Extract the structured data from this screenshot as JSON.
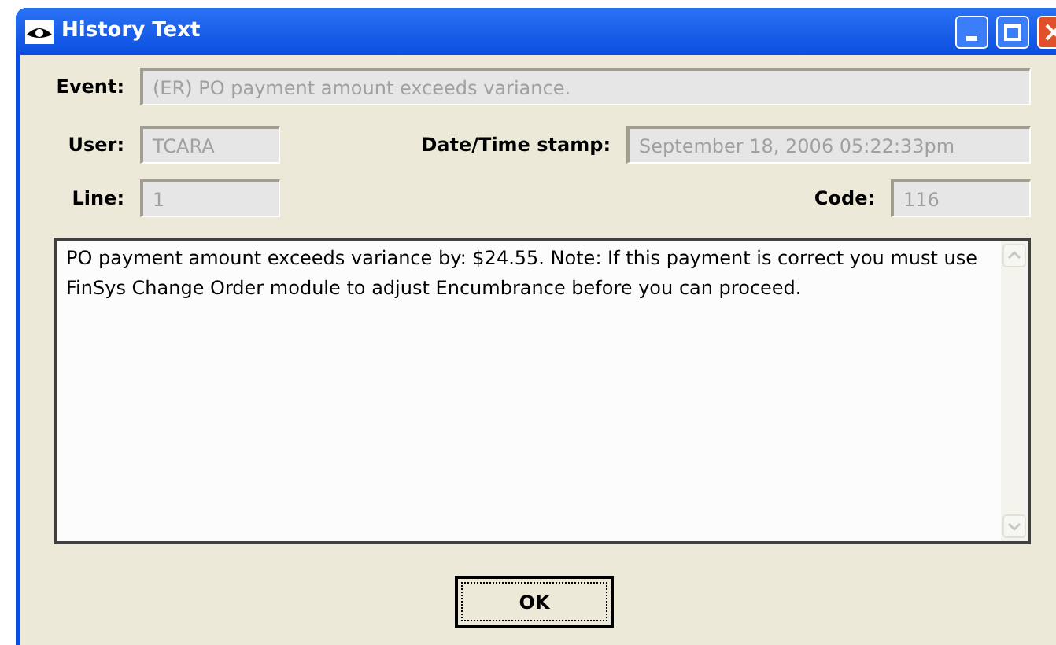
{
  "window": {
    "title": "History Text"
  },
  "fields": {
    "event": {
      "label": "Event:",
      "value": "(ER) PO payment amount exceeds variance.",
      "disabled": true
    },
    "user": {
      "label": "User:",
      "value": "TCARA",
      "disabled": true
    },
    "timestamp": {
      "label": "Date/Time stamp:",
      "value": "September 18, 2006 05:22:33pm",
      "disabled": true
    },
    "line": {
      "label": "Line:",
      "value": "1",
      "disabled": true
    },
    "code": {
      "label": "Code:",
      "value": "116",
      "disabled": true
    }
  },
  "message": "PO payment amount exceeds variance by: $24.55. Note: If this payment is correct you must use FinSys Change Order module to adjust Encumbrance before you can proceed.",
  "buttons": [
    "OK"
  ]
}
